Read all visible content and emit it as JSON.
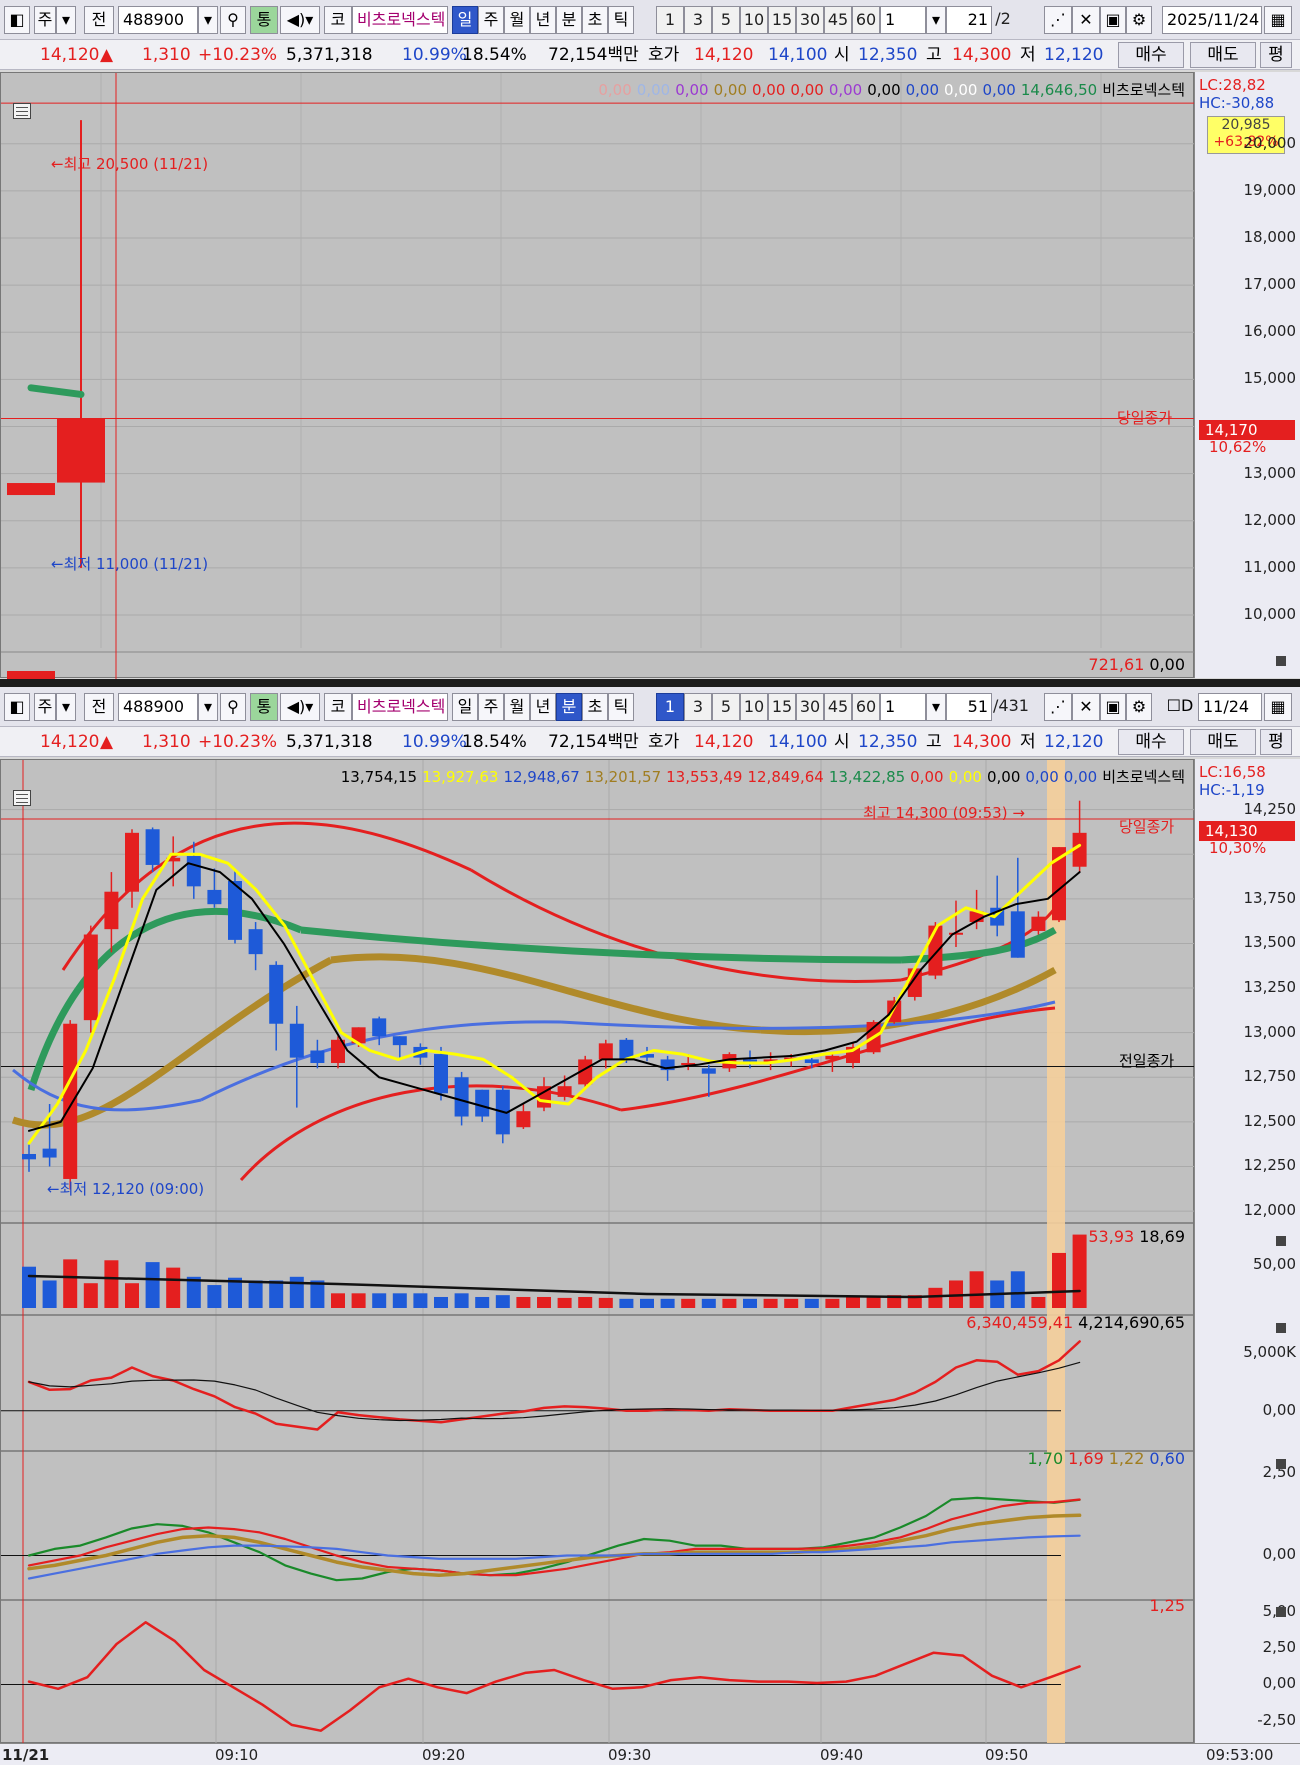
{
  "window1": {
    "toolbar": {
      "market": "주",
      "prev": "전",
      "code": "488900",
      "link": "통",
      "exchange": "코",
      "name": "비츠로넥스텍",
      "periods": [
        "일",
        "주",
        "월",
        "년",
        "분",
        "초",
        "틱"
      ],
      "active": "일",
      "intervals": [
        "1",
        "3",
        "5",
        "10",
        "15",
        "30",
        "45",
        "60"
      ],
      "count": "1",
      "page": "21",
      "total": "/2",
      "date": "2025/11/24"
    },
    "quote": {
      "price": "14,120",
      "arrow": "▲",
      "change": "1,310",
      "pct": "+10.23%",
      "volume": "5,371,318",
      "turnover": "10.99%",
      "rate2": "18.54%",
      "amount": "72,154백만",
      "hoga_label": "호가",
      "ask": "14,120",
      "bid": "14,100",
      "open_label": "시",
      "open": "12,350",
      "high_label": "고",
      "high": "14,300",
      "low_label": "저",
      "low": "12,120",
      "buy": "매수",
      "sell": "매도",
      "flat": "평"
    },
    "legend": [
      "0,00",
      "0,00",
      "0,00",
      "0,00",
      "0,00",
      "0,00",
      "0,00",
      "0,00",
      "0,00",
      "0,00",
      "0,00",
      "14,646,50",
      "비츠로넥스텍"
    ],
    "lc": "LC:28,82",
    "hc": "HC:-30,88",
    "badge_price": "20,985",
    "badge_pct": "+63,82%",
    "current_price": "14,170",
    "current_pct": "10,62%",
    "close_label": "당일종가",
    "hi_note": "최고 20,500 (11/21)",
    "lo_note": "최저 11,000 (11/21)",
    "yticks": [
      "20,000",
      "19,000",
      "18,000",
      "17,000",
      "16,000",
      "15,000",
      "13,000",
      "12,000",
      "11,000",
      "10,000"
    ],
    "ystep": "1,000",
    "vol_legend": [
      "721,61",
      "0,00"
    ],
    "yrange": [
      9300,
      21500
    ]
  },
  "window2": {
    "toolbar": {
      "market": "주",
      "prev": "전",
      "code": "488900",
      "link": "통",
      "exchange": "코",
      "name": "비츠로넥스텍",
      "periods": [
        "일",
        "주",
        "월",
        "년",
        "분",
        "초",
        "틱"
      ],
      "active": "분",
      "intervals": [
        "1",
        "3",
        "5",
        "10",
        "15",
        "30",
        "45",
        "60"
      ],
      "active_interval": "1",
      "count": "1",
      "page": "51",
      "total": "/431",
      "check": "D",
      "date": "11/24"
    },
    "quote": {
      "price": "14,120",
      "arrow": "▲",
      "change": "1,310",
      "pct": "+10.23%",
      "volume": "5,371,318",
      "turnover": "10.99%",
      "rate2": "18.54%",
      "amount": "72,154백만",
      "hoga_label": "호가",
      "ask": "14,120",
      "bid": "14,100",
      "open_label": "시",
      "open": "12,350",
      "high_label": "고",
      "high": "14,300",
      "low_label": "저",
      "low": "12,120",
      "buy": "매수",
      "sell": "매도",
      "flat": "평"
    },
    "legend": [
      "13,754,15",
      "13,927,63",
      "12,948,67",
      "13,201,57",
      "13,553,49",
      "12,849,64",
      "13,422,85",
      "0,00",
      "0,00",
      "0,00",
      "0,00",
      "0,00",
      "비츠로넥스텍"
    ],
    "lc": "LC:16,58",
    "hc": "HC:-1,19",
    "current_price": "14,130",
    "current_pct": "10,30%",
    "close_label": "당일종가",
    "prev_close_label": "전일종가",
    "hi_note": "최고 14,300 (09:53)",
    "lo_note": "최저 12,120 (09:00)",
    "yticks": [
      "14,250",
      "13,750",
      "13,500",
      "13,250",
      "13,000",
      "12,750",
      "12,500",
      "12,250",
      "12,000"
    ],
    "vol_legend": [
      "53,93",
      "18,69"
    ],
    "vol_tick": "50,00",
    "obv_legend": [
      "6,340,459,41",
      "4,214,690,65"
    ],
    "obv_ticks": [
      "5,000K",
      "0,00"
    ],
    "macd_legend": [
      "1,70",
      "1,69",
      "1,22",
      "0,60"
    ],
    "macd_ticks": [
      "2,50",
      "0,00"
    ],
    "osc_legend": "1,25",
    "osc_ticks": [
      "5,00",
      "2,50",
      "0,00",
      "-2,50"
    ],
    "xaxis": [
      "11/21",
      "09:10",
      "09:20",
      "09:30",
      "09:40",
      "09:50",
      "09:53:00"
    ]
  },
  "chart_data": [
    {
      "type": "candlestick",
      "title": "비츠로넥스텍 일봉",
      "candles": [
        {
          "o": 12800,
          "h": 12800,
          "l": 12700,
          "c": 12700
        },
        {
          "o": 12810,
          "h": 20500,
          "l": 11000,
          "c": 14170
        }
      ],
      "series": [
        {
          "name": "MA",
          "values": [
            14820,
            14680
          ]
        }
      ],
      "ylim": [
        9300,
        21500
      ]
    },
    {
      "type": "candlestick",
      "title": "비츠로넥스텍 1분봉",
      "ylim": [
        11950,
        14360
      ],
      "candles": [
        {
          "o": 12320,
          "h": 12380,
          "l": 12220,
          "c": 12290
        },
        {
          "o": 12350,
          "h": 12600,
          "l": 12250,
          "c": 12300
        },
        {
          "o": 12180,
          "h": 13070,
          "l": 12120,
          "c": 13050
        },
        {
          "o": 13070,
          "h": 13600,
          "l": 13000,
          "c": 13550
        },
        {
          "o": 13580,
          "h": 13900,
          "l": 13450,
          "c": 13790
        },
        {
          "o": 13790,
          "h": 14140,
          "l": 13700,
          "c": 14120
        },
        {
          "o": 14140,
          "h": 14150,
          "l": 13900,
          "c": 13940
        },
        {
          "o": 13960,
          "h": 14100,
          "l": 13820,
          "c": 13980
        },
        {
          "o": 13990,
          "h": 14070,
          "l": 13750,
          "c": 13820
        },
        {
          "o": 13800,
          "h": 13920,
          "l": 13700,
          "c": 13720
        },
        {
          "o": 13850,
          "h": 13910,
          "l": 13500,
          "c": 13520
        },
        {
          "o": 13580,
          "h": 13620,
          "l": 13350,
          "c": 13440
        },
        {
          "o": 13380,
          "h": 13400,
          "l": 12900,
          "c": 13050
        },
        {
          "o": 13050,
          "h": 13150,
          "l": 12580,
          "c": 12860
        },
        {
          "o": 12900,
          "h": 12960,
          "l": 12800,
          "c": 12830
        },
        {
          "o": 12830,
          "h": 12980,
          "l": 12800,
          "c": 12960
        },
        {
          "o": 12940,
          "h": 13030,
          "l": 12920,
          "c": 13030
        },
        {
          "o": 13080,
          "h": 13090,
          "l": 12930,
          "c": 12980
        },
        {
          "o": 12980,
          "h": 12980,
          "l": 12850,
          "c": 12930
        },
        {
          "o": 12920,
          "h": 12940,
          "l": 12820,
          "c": 12860
        },
        {
          "o": 12880,
          "h": 12920,
          "l": 12620,
          "c": 12660
        },
        {
          "o": 12750,
          "h": 12780,
          "l": 12480,
          "c": 12530
        },
        {
          "o": 12680,
          "h": 12680,
          "l": 12500,
          "c": 12530
        },
        {
          "o": 12680,
          "h": 12700,
          "l": 12380,
          "c": 12430
        },
        {
          "o": 12470,
          "h": 12600,
          "l": 12460,
          "c": 12560
        },
        {
          "o": 12580,
          "h": 12750,
          "l": 12560,
          "c": 12700
        },
        {
          "o": 12640,
          "h": 12760,
          "l": 12620,
          "c": 12700
        },
        {
          "o": 12710,
          "h": 12870,
          "l": 12690,
          "c": 12850
        },
        {
          "o": 12850,
          "h": 12960,
          "l": 12800,
          "c": 12940
        },
        {
          "o": 12960,
          "h": 12970,
          "l": 12830,
          "c": 12850
        },
        {
          "o": 12880,
          "h": 12920,
          "l": 12840,
          "c": 12860
        },
        {
          "o": 12850,
          "h": 12870,
          "l": 12730,
          "c": 12790
        },
        {
          "o": 12820,
          "h": 12880,
          "l": 12790,
          "c": 12830
        },
        {
          "o": 12800,
          "h": 12820,
          "l": 12640,
          "c": 12770
        },
        {
          "o": 12800,
          "h": 12890,
          "l": 12780,
          "c": 12880
        },
        {
          "o": 12850,
          "h": 12900,
          "l": 12800,
          "c": 12840
        },
        {
          "o": 12830,
          "h": 12890,
          "l": 12790,
          "c": 12850
        },
        {
          "o": 12850,
          "h": 12880,
          "l": 12810,
          "c": 12860
        },
        {
          "o": 12850,
          "h": 12870,
          "l": 12800,
          "c": 12830
        },
        {
          "o": 12850,
          "h": 12880,
          "l": 12780,
          "c": 12870
        },
        {
          "o": 12830,
          "h": 12940,
          "l": 12800,
          "c": 12920
        },
        {
          "o": 12890,
          "h": 13070,
          "l": 12880,
          "c": 13060
        },
        {
          "o": 13060,
          "h": 13200,
          "l": 13050,
          "c": 13180
        },
        {
          "o": 13200,
          "h": 13370,
          "l": 13180,
          "c": 13360
        },
        {
          "o": 13320,
          "h": 13620,
          "l": 13300,
          "c": 13600
        },
        {
          "o": 13550,
          "h": 13740,
          "l": 13480,
          "c": 13560
        },
        {
          "o": 13620,
          "h": 13800,
          "l": 13580,
          "c": 13680
        },
        {
          "o": 13700,
          "h": 13880,
          "l": 13540,
          "c": 13600
        },
        {
          "o": 13680,
          "h": 13980,
          "l": 13420,
          "c": 13420
        },
        {
          "o": 13570,
          "h": 13680,
          "l": 13550,
          "c": 13650
        },
        {
          "o": 13630,
          "h": 14040,
          "l": 13620,
          "c": 14040
        },
        {
          "o": 13930,
          "h": 14300,
          "l": 13900,
          "c": 14120
        }
      ],
      "volume": [
        45,
        30,
        53,
        27,
        52,
        27,
        50,
        44,
        34,
        25,
        33,
        30,
        30,
        34,
        30,
        16,
        16,
        16,
        16,
        16,
        12,
        16,
        12,
        14,
        12,
        12,
        11,
        12,
        11,
        10,
        10,
        10,
        10,
        10,
        10,
        10,
        10,
        10,
        10,
        10,
        12,
        12,
        14,
        14,
        22,
        30,
        40,
        30,
        40,
        12,
        60,
        80
      ],
      "obv": [
        400,
        290,
        300,
        420,
        460,
        600,
        480,
        420,
        300,
        200,
        50,
        -40,
        -180,
        -220,
        -260,
        -20,
        -60,
        -90,
        -120,
        -140,
        -160,
        -120,
        -80,
        -40,
        -10,
        40,
        60,
        50,
        30,
        0,
        0,
        20,
        10,
        0,
        20,
        10,
        0,
        0,
        0,
        0,
        50,
        100,
        150,
        250,
        400,
        600,
        700,
        680,
        500,
        550,
        700,
        960
      ],
      "macd": [
        {
          "name": "MACD",
          "values": [
            0.0,
            0.2,
            0.3,
            0.55,
            0.82,
            0.95,
            0.9,
            0.7,
            0.4,
            0.1,
            -0.3,
            -0.55,
            -0.75,
            -0.7,
            -0.5,
            -0.4,
            -0.45,
            -0.55,
            -0.6,
            -0.55,
            -0.4,
            -0.2,
            0.05,
            0.3,
            0.5,
            0.45,
            0.3,
            0.3,
            0.2,
            0.2,
            0.2,
            0.25,
            0.4,
            0.55,
            0.85,
            1.2,
            1.7,
            1.75,
            1.7,
            1.65,
            1.6,
            1.69
          ]
        },
        {
          "name": "Signal",
          "values": [
            -0.3,
            -0.15,
            0.0,
            0.25,
            0.45,
            0.65,
            0.8,
            0.85,
            0.8,
            0.7,
            0.5,
            0.25,
            0.0,
            -0.2,
            -0.35,
            -0.4,
            -0.45,
            -0.55,
            -0.6,
            -0.6,
            -0.5,
            -0.4,
            -0.25,
            -0.1,
            0.05,
            0.1,
            0.2,
            0.2,
            0.2,
            0.2,
            0.2,
            0.22,
            0.3,
            0.4,
            0.55,
            0.8,
            1.1,
            1.3,
            1.5,
            1.6,
            1.62,
            1.7
          ]
        },
        {
          "name": "MA1",
          "values": [
            -0.4,
            -0.3,
            -0.15,
            0.0,
            0.2,
            0.4,
            0.55,
            0.6,
            0.55,
            0.4,
            0.2,
            0.0,
            -0.2,
            -0.35,
            -0.45,
            -0.55,
            -0.6,
            -0.55,
            -0.45,
            -0.35,
            -0.25,
            -0.15,
            -0.05,
            0.0,
            0.05,
            0.05,
            0.1,
            0.1,
            0.1,
            0.1,
            0.1,
            0.15,
            0.2,
            0.3,
            0.45,
            0.6,
            0.8,
            0.95,
            1.05,
            1.15,
            1.2,
            1.22
          ]
        },
        {
          "name": "MA2",
          "values": [
            -0.7,
            -0.55,
            -0.4,
            -0.25,
            -0.1,
            0.05,
            0.15,
            0.25,
            0.3,
            0.3,
            0.28,
            0.25,
            0.2,
            0.1,
            0.0,
            -0.05,
            -0.1,
            -0.1,
            -0.1,
            -0.1,
            -0.05,
            0.0,
            0.0,
            0.0,
            0.05,
            0.05,
            0.05,
            0.05,
            0.05,
            0.05,
            0.1,
            0.1,
            0.15,
            0.2,
            0.25,
            0.3,
            0.4,
            0.45,
            0.5,
            0.55,
            0.58,
            0.6
          ]
        }
      ],
      "osc": [
        0.2,
        -0.3,
        0.5,
        2.8,
        4.3,
        3.0,
        1.0,
        -0.2,
        -1.4,
        -2.8,
        -3.2,
        -1.8,
        -0.2,
        0.4,
        -0.2,
        -0.6,
        0.2,
        0.8,
        1.0,
        0.3,
        -0.3,
        -0.2,
        0.3,
        0.5,
        0.3,
        0.2,
        0.2,
        0.1,
        0.2,
        0.6,
        1.4,
        2.2,
        2.0,
        0.6,
        -0.2,
        0.5,
        1.25
      ],
      "overlays": [
        {
          "name": "MA5",
          "color": "#ffff00",
          "values": [
            12380,
            12600,
            12900,
            13300,
            13750,
            14000,
            14000,
            13950,
            13800,
            13600,
            13300,
            13000,
            12900,
            12850,
            12900,
            12880,
            12850,
            12750,
            12620,
            12600,
            12750,
            12850,
            12900,
            12880,
            12840,
            12830,
            12830,
            12850,
            12880,
            12900,
            13000,
            13300,
            13600,
            13700,
            13650,
            13800,
            13950,
            14050
          ]
        },
        {
          "name": "MA10",
          "color": "#000000",
          "values": [
            12450,
            12500,
            12800,
            13300,
            13800,
            13950,
            13900,
            13750,
            13500,
            13200,
            12900,
            12750,
            12700,
            12650,
            12600,
            12550,
            12650,
            12750,
            12850,
            12850,
            12800,
            12820,
            12850,
            12860,
            12870,
            12900,
            12950,
            13100,
            13350,
            13550,
            13650,
            13720,
            13750,
            13900
          ]
        }
      ]
    }
  ]
}
